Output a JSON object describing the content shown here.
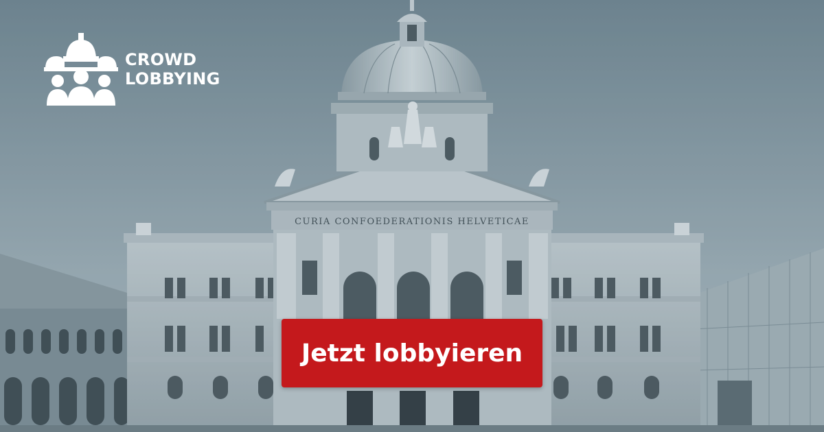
{
  "brand": {
    "line1": "CROWD",
    "line2": "LOBBYING",
    "logo_icon": "parliament-people-icon",
    "color": "#ffffff"
  },
  "building": {
    "inscription": "CURIA CONFOEDERATIONIS HELVETICAE"
  },
  "cta": {
    "label": "Jetzt lobbyieren",
    "color": "#c4191c"
  }
}
